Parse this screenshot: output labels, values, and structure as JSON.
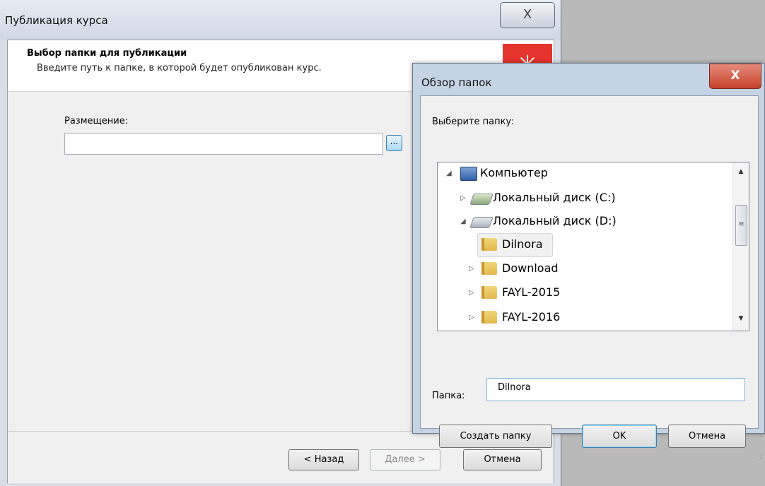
{
  "publish_dialog": {
    "title": "Публикация курса",
    "close_glyph": "X",
    "header_title": "Выбор папки для публикации",
    "header_subtitle": "Введите путь к папке, в которой будет опубликован курс.",
    "location_label": "Размещение:",
    "location_value": "",
    "browse_label": "...",
    "back_button": "< Назад",
    "next_button": "Далее >",
    "cancel_button": "Отмена"
  },
  "browse_dialog": {
    "title": "Обзор папок",
    "close_glyph": "X",
    "prompt": "Выберите папку:",
    "tree": [
      {
        "label": "Компьютер",
        "icon": "computer-icon",
        "expander": "◢"
      },
      {
        "label": "Локальный диск (C:)",
        "icon": "drive-c-icon",
        "expander": "▷"
      },
      {
        "label": "Локальный диск (D:)",
        "icon": "drive-d-icon",
        "expander": "◢"
      },
      {
        "label": "Dilnora",
        "icon": "folder-icon",
        "expander": "",
        "selected": true
      },
      {
        "label": "Download",
        "icon": "folder-icon",
        "expander": "▷"
      },
      {
        "label": "FAYL-2015",
        "icon": "folder-icon",
        "expander": "▷"
      },
      {
        "label": "FAYL-2016",
        "icon": "folder-icon",
        "expander": "▷"
      }
    ],
    "folder_label": "Папка:",
    "folder_value": "Dilnora",
    "create_folder_button": "Создать папку",
    "ok_button": "OK",
    "cancel_button": "Отмена"
  },
  "colors": {
    "accent_logo": "#e5342d",
    "close_red": "#c7402a"
  }
}
